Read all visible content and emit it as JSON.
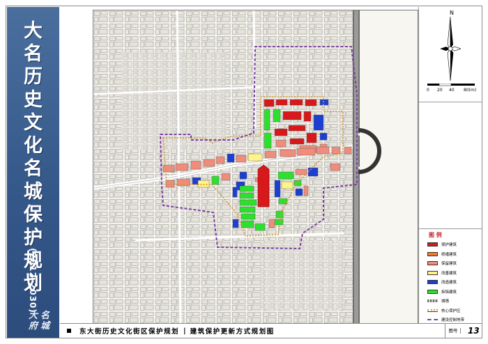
{
  "title": {
    "chars": [
      "大",
      "名",
      "历",
      "史",
      "文",
      "化",
      "名",
      "城",
      "保",
      "护",
      "规",
      "划"
    ],
    "years": "(2012-2030)",
    "seal_chars": [
      "大",
      "名",
      "府",
      "城"
    ]
  },
  "compass": {
    "north": "N"
  },
  "scale": {
    "ticks": [
      "0",
      "20",
      "40",
      "80(m)"
    ]
  },
  "legend": {
    "title": "图 例",
    "items": [
      {
        "label": "保护建筑",
        "color": "#d7191c",
        "kind": "fill"
      },
      {
        "label": "修缮建筑",
        "color": "#f47b20",
        "kind": "fill"
      },
      {
        "label": "保留建筑",
        "color": "#f08c7c",
        "kind": "fill"
      },
      {
        "label": "改善建筑",
        "color": "#fff38a",
        "kind": "fill"
      },
      {
        "label": "改造建筑",
        "color": "#1c3fd1",
        "kind": "fill"
      },
      {
        "label": "拆除建筑",
        "color": "#2ee02e",
        "kind": "fill"
      },
      {
        "label": "城墙",
        "color": "#a0a0a0",
        "kind": "wall"
      },
      {
        "label": "核心保护区",
        "color": "#d9942a",
        "kind": "dot-orange"
      },
      {
        "label": "建设控制地带",
        "color": "#7b3fa0",
        "kind": "dash-purple"
      }
    ]
  },
  "footer": {
    "left_title": "东大街历史文化街区保护规划",
    "separator": "|",
    "right_title": "建筑保护更新方式规划图",
    "fig_label": "图号",
    "fig_number": "13"
  }
}
